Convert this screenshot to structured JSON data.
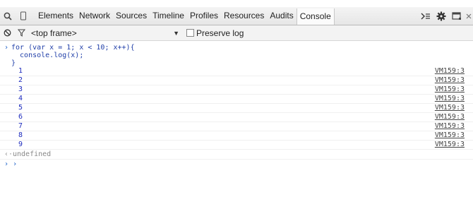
{
  "toolbar": {
    "tabs": [
      "Elements",
      "Network",
      "Sources",
      "Timeline",
      "Profiles",
      "Resources",
      "Audits",
      "Console"
    ],
    "active_tab": "Console",
    "icons": [
      "search-icon",
      "device-mode-icon",
      "drawer-toggle-icon",
      "settings-icon",
      "dock-icon",
      "close-icon"
    ]
  },
  "filterbar": {
    "frame_select": "<top frame>",
    "preserve_log_label": "Preserve log",
    "preserve_log_checked": false
  },
  "console": {
    "command_lines": [
      "for (var x = 1; x < 10; x++){",
      "  console.log(x);",
      "}"
    ],
    "logs": [
      {
        "value": "1",
        "source": "VM159:3"
      },
      {
        "value": "2",
        "source": "VM159:3"
      },
      {
        "value": "3",
        "source": "VM159:3"
      },
      {
        "value": "4",
        "source": "VM159:3"
      },
      {
        "value": "5",
        "source": "VM159:3"
      },
      {
        "value": "6",
        "source": "VM159:3"
      },
      {
        "value": "7",
        "source": "VM159:3"
      },
      {
        "value": "8",
        "source": "VM159:3"
      },
      {
        "value": "9",
        "source": "VM159:3"
      }
    ],
    "result": "undefined",
    "prompt_glyph": ">"
  },
  "colors": {
    "accent_blue": "#1f62c9",
    "log_value": "#1d2bbd"
  }
}
